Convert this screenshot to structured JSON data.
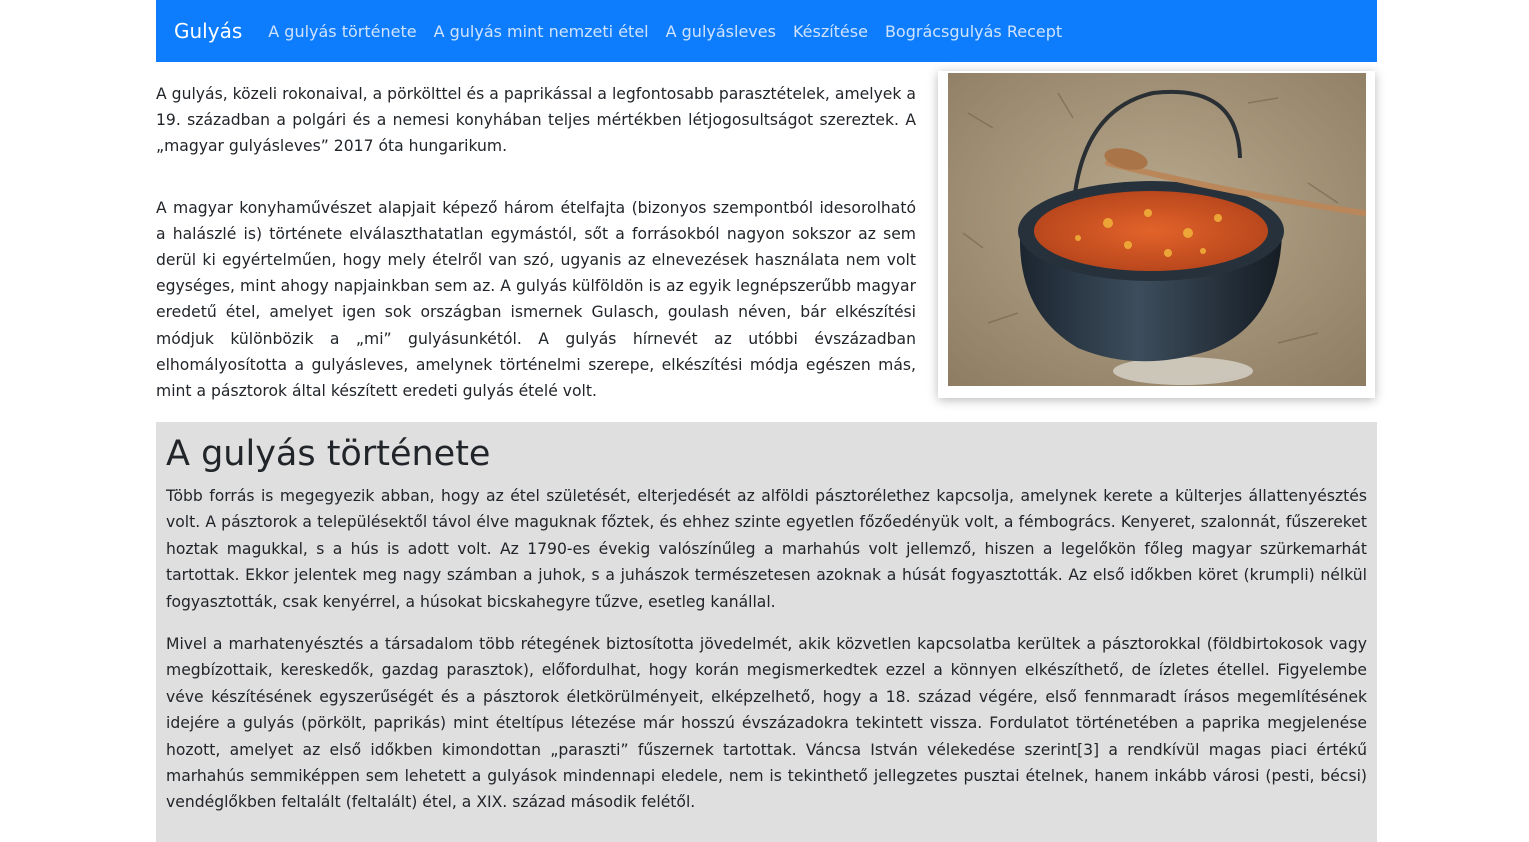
{
  "nav": {
    "brand": "Gulyás",
    "links": [
      "A gulyás története",
      "A gulyás mint nemzeti étel",
      "A gulyásleves",
      "Készítése",
      "Bográcsgulyás Recept"
    ]
  },
  "intro": {
    "paragraphs": [
      "A gulyás, közeli rokonaival, a pörkölttel és a paprikással a legfontosabb parasztételek, amelyek a 19. században a polgári és a nemesi konyhában teljes mértékben létjogosultságot szereztek. A „magyar gulyásleves” 2017 óta hungarikum.",
      "A magyar konyhaművészet alapjait képező három ételfajta (bizonyos szempontból idesorolható a halászlé is) története elválaszthatatlan egymástól, sőt a forrásokból nagyon sokszor az sem derül ki egyértelműen, hogy mely ételről van szó, ugyanis az elnevezések használata nem volt egységes, mint ahogy napjainkban sem az. A gulyás külföldön is az egyik legnépszerűbb magyar eredetű étel, amelyet igen sok országban ismernek Gulasch, goulash néven, bár elkészítési módjuk különbözik a „mi” gulyásunkétól. A gulyás hírnevét az utóbbi évszázadban elhomályosította a gulyásleves, amelynek történelmi szerepe, elkészítési módja egészen más, mint a pásztorok által készített eredeti gulyás ételé volt."
    ]
  },
  "history": {
    "title": "A gulyás története",
    "paragraphs": [
      "Több forrás is megegyezik abban, hogy az étel születését, elterjedését az alföldi pásztorélethez kapcsolja, amelynek kerete a külterjes állattenyésztés volt. A pásztorok a településektől távol élve maguknak főztek, és ehhez szinte egyetlen főzőedényük volt, a fémbogrács. Kenyeret, szalonnát, fűszereket hoztak magukkal, s a hús is adott volt. Az 1790-es évekig valószínűleg a marhahús volt jellemző, hiszen a legelőkön főleg magyar szürkemarhát tartottak. Ekkor jelentek meg nagy számban a juhok, s a juhászok természetesen azoknak a húsát fogyasztották. Az első időkben köret (krumpli) nélkül fogyasztották, csak kenyérrel, a húsokat bicskahegyre tűzve, esetleg kanállal.",
      "Mivel a marhatenyésztés a társadalom több rétegének biztosította jövedelmét, akik közvetlen kapcsolatba kerültek a pásztorokkal (földbirtokosok vagy megbízottaik, kereskedők, gazdag parasztok), előfordulhat, hogy korán megismerkedtek ezzel a könnyen elkészíthető, de ízletes étellel. Figyelembe véve készítésének egyszerűségét és a pásztorok életkörülményeit, elképzelhető, hogy a 18. század végére, első fennmaradt írásos megemlítésének idejére a gulyás (pörkölt, paprikás) mint ételtípus létezése már hosszú évszázadokra tekintett vissza. Fordulatot történetében a paprika megjelenése hozott, amelyet az első időkben kimondottan „paraszti” fűszernek tartottak. Váncsa István vélekedése szerint[3] a rendkívül magas piaci értékű marhahús semmiképpen sem lehetett a gulyások mindennapi eledele, nem is tekinthető jellegzetes pusztai ételnek, hanem inkább városi (pesti, bécsi) vendéglőkben feltalált (feltalált) étel, a XIX. század második felétől."
    ]
  },
  "colors": {
    "navbar_bg": "#0d7dfd",
    "section_bg": "#dfdfdf"
  }
}
